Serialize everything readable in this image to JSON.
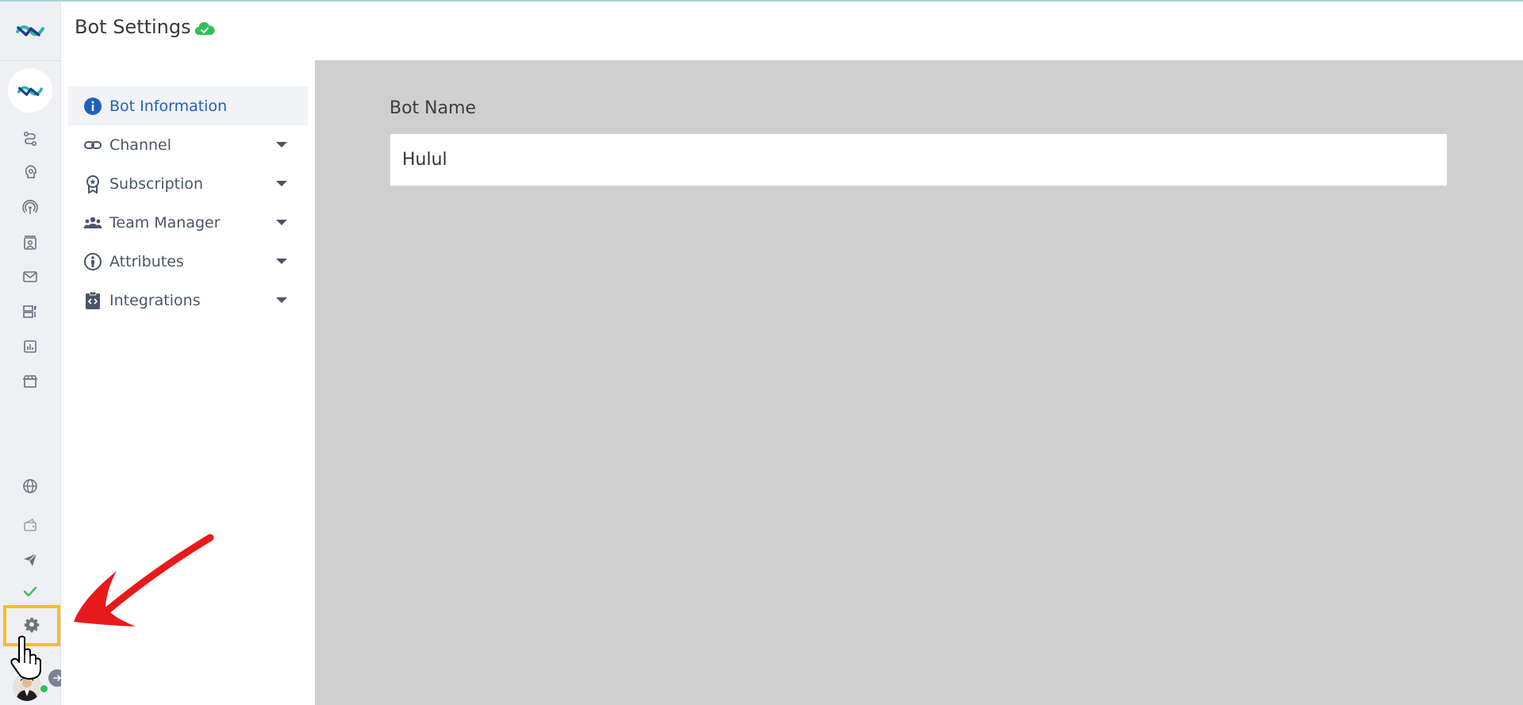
{
  "header": {
    "title": "Bot Settings"
  },
  "nav": {
    "items": [
      {
        "label": "Bot Information"
      },
      {
        "label": "Channel"
      },
      {
        "label": "Subscription"
      },
      {
        "label": "Team Manager"
      },
      {
        "label": "Attributes"
      },
      {
        "label": "Integrations"
      }
    ]
  },
  "form": {
    "bot_name_label": "Bot Name",
    "bot_name_value": "Hulul"
  },
  "rail": {
    "icons": [
      "app-logo",
      "flow-icon",
      "ai-brain-icon",
      "broadcast-icon",
      "contacts-icon",
      "mail-icon",
      "templates-icon",
      "analytics-icon",
      "store-icon",
      "globe-icon",
      "wallet-icon",
      "send-icon",
      "check-icon",
      "gear-icon"
    ]
  },
  "colors": {
    "accent": "#1f5fbf",
    "highlight": "#f7bd22",
    "annotation": "#e8191b",
    "saved": "#2fbf5a"
  }
}
